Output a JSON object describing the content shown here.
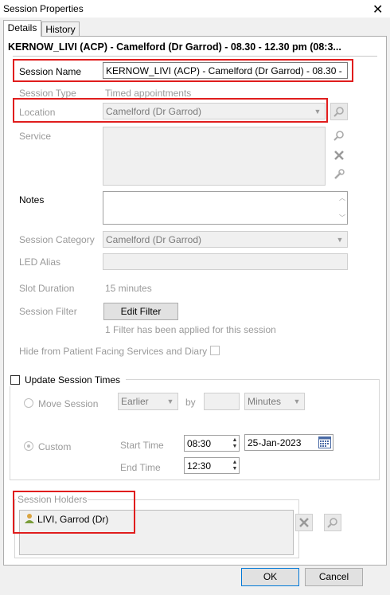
{
  "window": {
    "title": "Session Properties",
    "close_glyph": "✕"
  },
  "tabs": [
    {
      "label": "Details"
    },
    {
      "label": "History"
    }
  ],
  "header": {
    "title": "KERNOW_LIVI (ACP) - Camelford (Dr Garrod) - 08.30 - 12.30 pm (08:3..."
  },
  "session_name": {
    "label": "Session Name",
    "value": "KERNOW_LIVI (ACP) - Camelford (Dr Garrod) - 08.30 -"
  },
  "session_type": {
    "label": "Session Type",
    "value": "Timed appointments"
  },
  "location": {
    "label": "Location",
    "value": "Camelford (Dr Garrod)"
  },
  "service": {
    "label": "Service"
  },
  "notes": {
    "label": "Notes",
    "value": ""
  },
  "session_category": {
    "label": "Session Category",
    "value": "Camelford (Dr Garrod)"
  },
  "led_alias": {
    "label": "LED Alias",
    "value": ""
  },
  "slot_duration": {
    "label": "Slot Duration",
    "value": "15 minutes"
  },
  "session_filter": {
    "label": "Session Filter",
    "button": "Edit Filter",
    "info": "1 Filter has been applied for this session"
  },
  "hide_patient": {
    "label": "Hide from Patient Facing Services and Diary",
    "checked": false
  },
  "update_times": {
    "label": "Update Session Times",
    "checked": false,
    "move_session": {
      "label": "Move Session",
      "direction": "Earlier",
      "by_label": "by",
      "amount": "",
      "unit": "Minutes"
    },
    "custom": {
      "label": "Custom",
      "start_label": "Start Time",
      "start_value": "08:30",
      "date_value": "25-Jan-2023",
      "end_label": "End Time",
      "end_value": "12:30"
    }
  },
  "session_holders": {
    "label": "Session Holders",
    "items": [
      {
        "name": "LIVI, Garrod (Dr)"
      }
    ]
  },
  "footer": {
    "ok": "OK",
    "cancel": "Cancel"
  },
  "colors": {
    "highlight": "#e01d1d",
    "disabled_text": "#9a9a9a"
  }
}
